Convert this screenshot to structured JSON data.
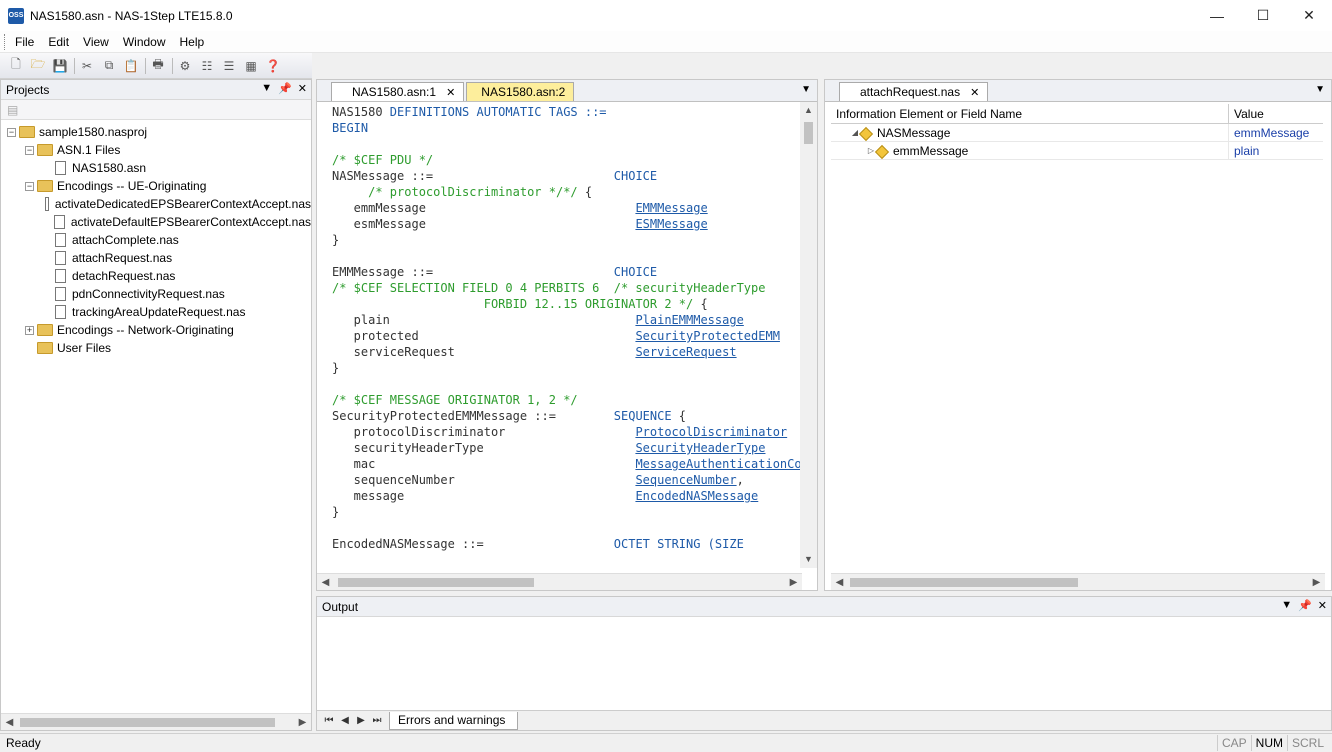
{
  "window": {
    "app_icon_text": "OSS",
    "title": "NAS1580.asn - NAS-1Step LTE15.8.0",
    "minimize": "—",
    "maximize": "☐",
    "close": "✕"
  },
  "menu": [
    "File",
    "Edit",
    "View",
    "Window",
    "Help"
  ],
  "projects": {
    "title": "Projects",
    "tree": [
      {
        "label": "sample1580.nasproj",
        "type": "folder",
        "level": 0,
        "expanded": true
      },
      {
        "label": "ASN.1 Files",
        "type": "folder",
        "level": 1,
        "expanded": true
      },
      {
        "label": "NAS1580.asn",
        "type": "file",
        "level": 2
      },
      {
        "label": "Encodings -- UE-Originating",
        "type": "folder",
        "level": 1,
        "expanded": true
      },
      {
        "label": "activateDedicatedEPSBearerContextAccept.nas",
        "type": "file",
        "level": 2
      },
      {
        "label": "activateDefaultEPSBearerContextAccept.nas",
        "type": "file",
        "level": 2
      },
      {
        "label": "attachComplete.nas",
        "type": "file",
        "level": 2
      },
      {
        "label": "attachRequest.nas",
        "type": "file",
        "level": 2
      },
      {
        "label": "detachRequest.nas",
        "type": "file",
        "level": 2
      },
      {
        "label": "pdnConnectivityRequest.nas",
        "type": "file",
        "level": 2
      },
      {
        "label": "trackingAreaUpdateRequest.nas",
        "type": "file",
        "level": 2
      },
      {
        "label": "Encodings -- Network-Originating",
        "type": "folder",
        "level": 1,
        "expanded": false
      },
      {
        "label": "User Files",
        "type": "folder",
        "level": 1,
        "expanded": null
      }
    ]
  },
  "editor": {
    "tabs": [
      {
        "label": "NAS1580.asn:1",
        "active": true
      },
      {
        "label": "NAS1580.asn:2",
        "active": false
      }
    ],
    "lines": [
      [
        [
          "pl",
          "NAS1580 "
        ],
        [
          "kw",
          "DEFINITIONS AUTOMATIC TAGS ::="
        ]
      ],
      [
        [
          "kw",
          "BEGIN"
        ]
      ],
      [],
      [
        [
          "cm",
          "/* $CEF PDU */"
        ]
      ],
      [
        [
          "pl",
          "NASMessage ::=                         "
        ],
        [
          "tp",
          "CHOICE"
        ]
      ],
      [
        [
          "cm",
          "     /* protocolDiscriminator */*/ "
        ],
        [
          "pl",
          "{"
        ]
      ],
      [
        [
          "pl",
          "   emmMessage                             "
        ],
        [
          "lnk",
          "EMMMessage"
        ]
      ],
      [
        [
          "pl",
          "   esmMessage                             "
        ],
        [
          "lnk",
          "ESMMessage"
        ]
      ],
      [
        [
          "pl",
          "}"
        ]
      ],
      [],
      [
        [
          "pl",
          "EMMMessage ::=                         "
        ],
        [
          "tp",
          "CHOICE"
        ]
      ],
      [
        [
          "cm",
          "/* $CEF SELECTION FIELD 0 4 PERBITS 6  /* securityHeaderType"
        ]
      ],
      [
        [
          "cm",
          "                     FORBID 12..15 ORIGINATOR 2 */ "
        ],
        [
          "pl",
          "{"
        ]
      ],
      [
        [
          "pl",
          "   plain                                  "
        ],
        [
          "lnk",
          "PlainEMMMessage"
        ]
      ],
      [
        [
          "pl",
          "   protected                              "
        ],
        [
          "lnk",
          "SecurityProtectedEMM"
        ]
      ],
      [
        [
          "pl",
          "   serviceRequest                         "
        ],
        [
          "lnk",
          "ServiceRequest"
        ]
      ],
      [
        [
          "pl",
          "}"
        ]
      ],
      [],
      [
        [
          "cm",
          "/* $CEF MESSAGE ORIGINATOR 1, 2 */"
        ]
      ],
      [
        [
          "pl",
          "SecurityProtectedEMMMessage ::=        "
        ],
        [
          "tp",
          "SEQUENCE "
        ],
        [
          "pl",
          "{"
        ]
      ],
      [
        [
          "pl",
          "   protocolDiscriminator                  "
        ],
        [
          "lnk",
          "ProtocolDiscriminator"
        ]
      ],
      [
        [
          "pl",
          "   securityHeaderType                     "
        ],
        [
          "lnk",
          "SecurityHeaderType"
        ]
      ],
      [
        [
          "pl",
          "   mac                                    "
        ],
        [
          "lnk",
          "MessageAuthenticationCode"
        ]
      ],
      [
        [
          "pl",
          "   sequenceNumber                         "
        ],
        [
          "lnk",
          "SequenceNumber"
        ],
        [
          "pl",
          ","
        ]
      ],
      [
        [
          "pl",
          "   message                                "
        ],
        [
          "lnk",
          "EncodedNASMessage"
        ]
      ],
      [
        [
          "pl",
          "}"
        ]
      ],
      [],
      [
        [
          "pl",
          "EncodedNASMessage ::=                  "
        ],
        [
          "tp",
          "OCTET STRING (SIZE"
        ]
      ]
    ]
  },
  "message_panel": {
    "tab": "attachRequest.nas",
    "columns": [
      "Information Element or Field Name",
      "Value"
    ],
    "rows": [
      {
        "name": "NASMessage",
        "value": "emmMessage",
        "level": 0,
        "expander": "◢"
      },
      {
        "name": "emmMessage",
        "value": "plain",
        "level": 1,
        "expander": "▷"
      }
    ]
  },
  "output": {
    "title": "Output",
    "tab": "Errors and warnings"
  },
  "status": {
    "text": "Ready",
    "indicators": [
      {
        "label": "CAP",
        "on": false
      },
      {
        "label": "NUM",
        "on": true
      },
      {
        "label": "SCRL",
        "on": false
      }
    ]
  }
}
